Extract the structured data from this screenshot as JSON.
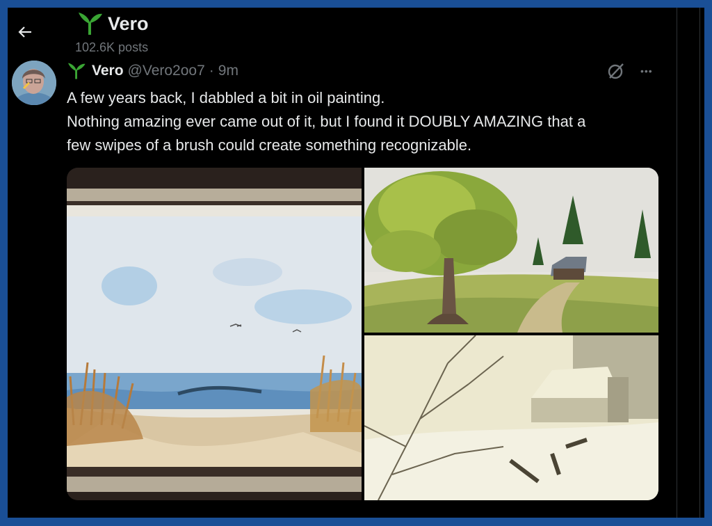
{
  "header": {
    "back_icon": "arrow-left-icon",
    "name": "Vero",
    "name_icon": "seedling-icon",
    "posts_count": "102.6K posts"
  },
  "tweet": {
    "avatar_icon": "avatar-photo",
    "name": "Vero",
    "name_icon": "seedling-icon",
    "handle": "@Vero2oo7",
    "separator": "·",
    "time": "9m",
    "grok_icon": "slashed-circle-icon",
    "more_label": "•••",
    "text_lines": [
      "A few years back, I dabbled a bit in oil painting.",
      "Nothing amazing ever came out of it, but I found it DOUBLY AMAZING that a",
      "few swipes of a brush could create something recognizable."
    ]
  },
  "media": {
    "images": [
      "seascape-painting",
      "tree-cabin-painting",
      "snowy-barn-painting"
    ]
  },
  "colors": {
    "background": "#000000",
    "border": "#1a4f96",
    "text_primary": "#e7e9ea",
    "text_secondary": "#71767b",
    "seedling": "#3aa534"
  }
}
